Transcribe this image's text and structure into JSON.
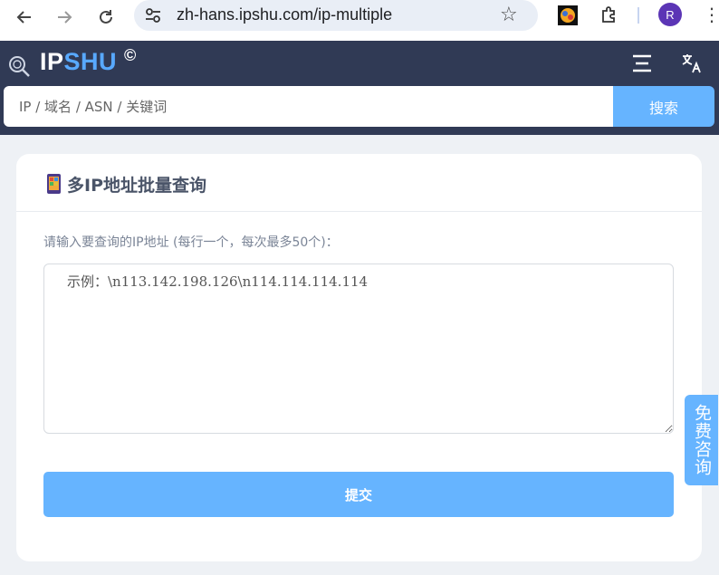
{
  "browser": {
    "url": "zh-hans.ipshu.com/ip-multiple",
    "profile_initial": "R"
  },
  "header": {
    "logo_ip": "IP",
    "logo_shu": "SHU",
    "logo_mark": "©",
    "search_placeholder": "IP / 域名 / ASN / 关键词",
    "search_button": "搜索"
  },
  "card": {
    "title": "多IP地址批量查询",
    "hint": "请输入要查询的IP地址 (每行一个，每次最多50个)：",
    "textarea_placeholder": "示例：\\n113.142.198.126\\n114.114.114.114",
    "submit_label": "提交"
  },
  "consult": {
    "label": "免费咨询"
  },
  "colors": {
    "header_bg": "#303a55",
    "accent": "#66b4ff",
    "page_bg": "#eef1f5"
  }
}
